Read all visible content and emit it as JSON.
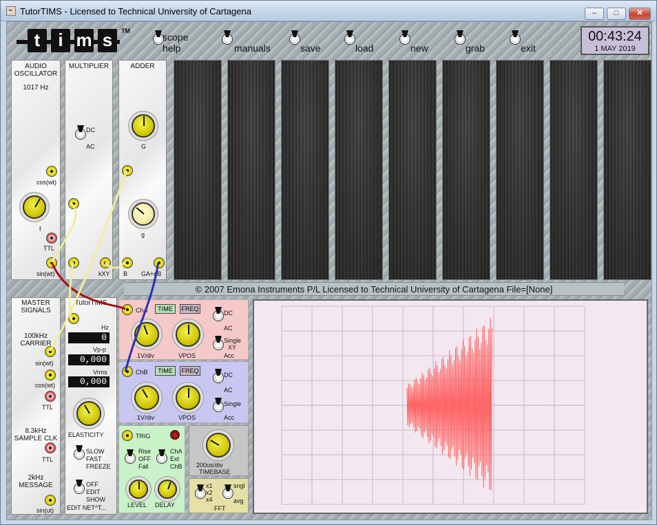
{
  "window": {
    "title": "TutorTIMS - Licensed to Technical University of Cartagena",
    "min": "–",
    "max": "□",
    "close": "✕"
  },
  "logo": {
    "letters": [
      "t",
      "i",
      "m",
      "s"
    ],
    "tm": "TM"
  },
  "toolbar": {
    "scope": "scope",
    "help": "help",
    "manuals": "manuals",
    "save": "save",
    "load": "load",
    "new": "new",
    "grab": "grab",
    "exit": "exit"
  },
  "clock": {
    "time": "00:43:24",
    "date": "1 MAY 2019"
  },
  "audio_osc": {
    "title1": "AUDIO",
    "title2": "OSCILLATOR",
    "freq": "1017 Hz",
    "cos": "cos(wt)",
    "knob": "f",
    "ttl": "TTL",
    "sin": "sin(wt)"
  },
  "multiplier": {
    "title": "MULTIPLIER",
    "dc": "DC",
    "ac": "AC",
    "out": "kXY"
  },
  "adder": {
    "title": "ADDER",
    "g_upper": "G",
    "g_lower": "g",
    "b": "B",
    "out": "GA+gB"
  },
  "banner": "© 2007 Emona Instruments P/L  Licensed to Technical University of Cartagena    File=[None]",
  "master": {
    "title1": "MASTER",
    "title2": "SIGNALS",
    "carrier1": "100kHz",
    "carrier2": "CARRIER",
    "sin": "sin(wt)",
    "cos": "cos(wt)",
    "ttl": "TTL",
    "sclk1": "8.3kHz",
    "sclk2": "SAMPLE CLK",
    "ttl2": "TTL",
    "msg1": "2kHz",
    "msg2": "MESSAGE",
    "sinut": "sin(ut)"
  },
  "tutor": {
    "title": "TutorTIMS",
    "hz": "Hz",
    "hz_val": "0",
    "vpp": "Vp-p",
    "vpp_val": "0,000",
    "vrms": "Vrms",
    "vrms_val": "0,000",
    "elasticity": "ELASTICITY",
    "slow": "SLOW",
    "fast": "FAST",
    "freeze": "FREEZE",
    "off": "OFF",
    "edit": "EDIT",
    "show": "SHOW",
    "editnet": "EDIT NET^T..."
  },
  "cha": {
    "label": "ChA",
    "time": "TIME",
    "freq": "FREQ",
    "dc": "DC",
    "ac": "AC",
    "vdiv": "1V/div",
    "vpos": "VPOS",
    "single": "Single",
    "xy": "XY",
    "acc": "Acc"
  },
  "chb": {
    "label": "ChB",
    "time": "TIME",
    "freq": "FREQ",
    "dc": "DC",
    "ac": "AC",
    "vdiv": "1V/div",
    "vpos": "VPOS",
    "single": "Single",
    "acc": "Acc"
  },
  "trig": {
    "label": "TRIG",
    "rise": "Rise",
    "off": "OFF",
    "fall": "Fall",
    "cha": "ChA",
    "ext": "Ext",
    "chb": "ChB",
    "level": "LEVEL",
    "delay": "DELAY"
  },
  "timebase": {
    "val": "200us/div",
    "label": "TIMEBASE"
  },
  "fft": {
    "x1": "x1",
    "x2": "x2",
    "x4": "x4",
    "sngl": "sngl",
    "avg": "avg",
    "label": "FFT"
  },
  "colors": {
    "trace": "#ff5b5b",
    "wire_yellow": "#f2ec9a",
    "wire_red": "#a31111",
    "wire_blue": "#2a2fb0"
  }
}
